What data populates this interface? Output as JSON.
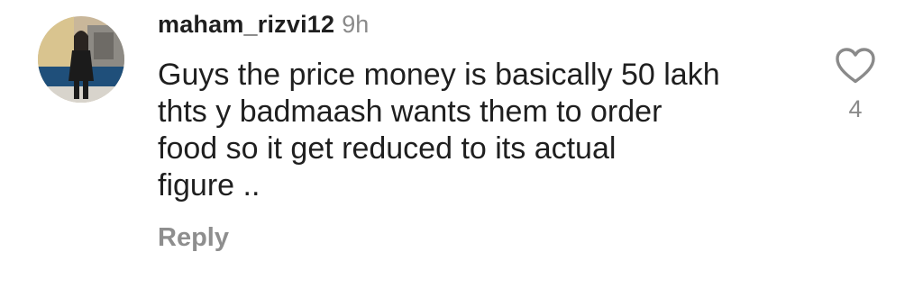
{
  "comment": {
    "username": "maham_rizvi12",
    "time_ago": "9h",
    "text_lines": [
      "Guys the price money is basically 50 lakh",
      "thts y badmaash wants them to order",
      "food so it get reduced to its actual",
      "figure .."
    ],
    "reply_label": "Reply",
    "like_count": "4",
    "like_icon": "heart-outline-icon",
    "avatar_icon": "profile-photo"
  }
}
